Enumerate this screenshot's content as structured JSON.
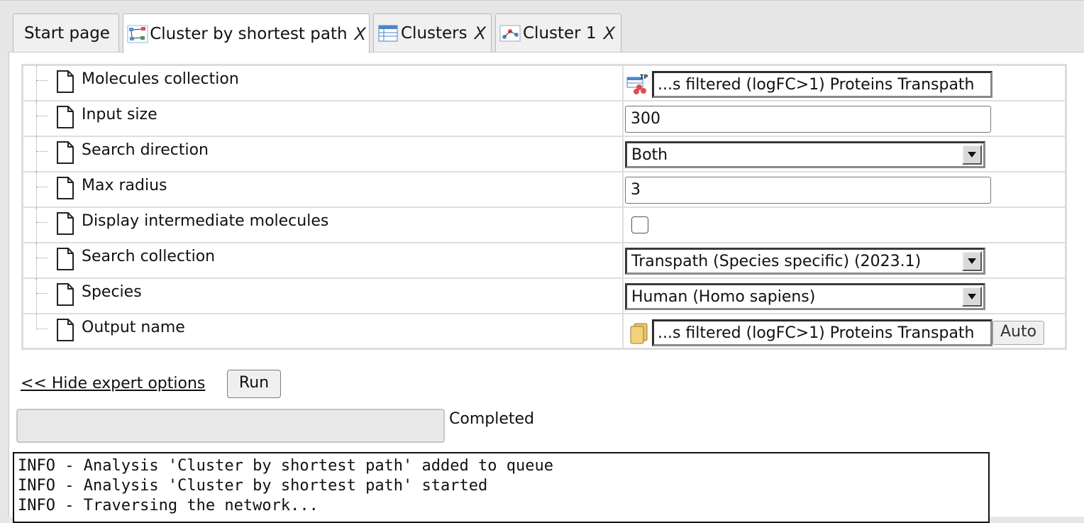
{
  "tabs": [
    {
      "label": "Start page",
      "icon": "none",
      "closable": false
    },
    {
      "label": "Cluster by shortest path",
      "icon": "cluster-analysis-icon",
      "closable": true
    },
    {
      "label": "Clusters",
      "icon": "table-icon",
      "closable": true
    },
    {
      "label": "Cluster 1",
      "icon": "diagram-icon",
      "closable": true
    }
  ],
  "close_glyph": "X",
  "options": {
    "molecules_collection": {
      "label": "Molecules collection",
      "value": "...s filtered (logFC>1) Proteins Transpath"
    },
    "input_size": {
      "label": "Input size",
      "value": "300"
    },
    "search_direction": {
      "label": "Search direction",
      "value": "Both"
    },
    "max_radius": {
      "label": "Max radius",
      "value": "3"
    },
    "display_intermediate": {
      "label": "Display intermediate molecules",
      "checked": false
    },
    "search_collection": {
      "label": "Search collection",
      "value": "Transpath (Species specific) (2023.1)"
    },
    "species": {
      "label": "Species",
      "value": "Human (Homo sapiens)"
    },
    "output_name": {
      "label": "Output name",
      "value": "...s filtered (logFC>1) Proteins Transpath",
      "auto_label": "Auto"
    }
  },
  "actions": {
    "hide_expert_label": "<< Hide expert options",
    "run_label": "Run"
  },
  "status": {
    "text": "Completed"
  },
  "log": [
    "INFO - Analysis 'Cluster by shortest path' added to queue",
    "INFO - Analysis 'Cluster by shortest path' started",
    "INFO - Traversing the network..."
  ]
}
